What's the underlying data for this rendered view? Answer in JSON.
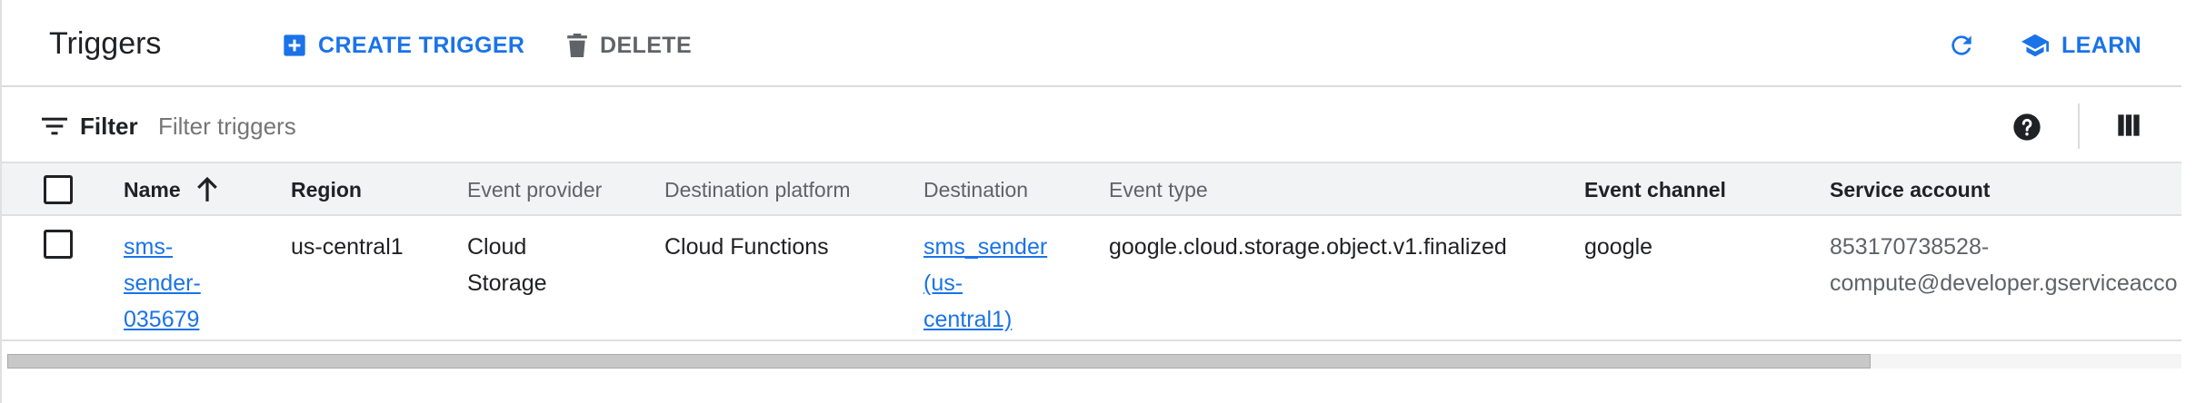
{
  "header": {
    "title": "Triggers",
    "create_label": "CREATE TRIGGER",
    "delete_label": "DELETE",
    "learn_label": "LEARN",
    "icons": {
      "create": "add-box-icon",
      "delete": "trash-icon",
      "refresh": "refresh-icon",
      "learn": "school-icon"
    }
  },
  "filter": {
    "label": "Filter",
    "placeholder": "Filter triggers",
    "value": "",
    "icons": {
      "filter": "filter-list-icon",
      "help": "help-icon",
      "columns": "column-display-icon"
    }
  },
  "table": {
    "columns": [
      "Name",
      "Region",
      "Event provider",
      "Destination platform",
      "Destination",
      "Event type",
      "Event channel",
      "Service account"
    ],
    "sort_icon": "arrow-up-icon",
    "rows": [
      {
        "name_lines": [
          "sms-",
          "sender-",
          "035679"
        ],
        "region": "us-central1",
        "event_provider_lines": [
          "Cloud",
          "Storage"
        ],
        "destination_platform": "Cloud Functions",
        "destination_lines": [
          "sms_sender",
          "(us-",
          "central1)"
        ],
        "event_type": "google.cloud.storage.object.v1.finalized",
        "event_channel": "google",
        "service_account_lines": [
          "853170738528-",
          "compute@developer.gserviceacco"
        ]
      }
    ]
  },
  "colors": {
    "accent": "#1a73e8",
    "text": "#202124",
    "muted": "#5f6368",
    "header_bg": "#f1f3f4",
    "border": "#e0e0e0"
  }
}
